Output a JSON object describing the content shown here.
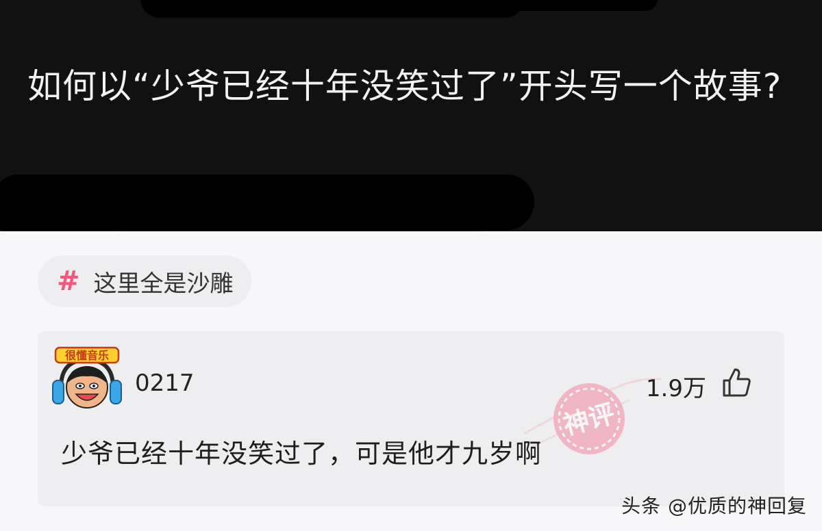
{
  "post": {
    "question": "如何以“少爷已经十年没笑过了”开头写一个故事?"
  },
  "topic": {
    "label": "这里全是沙雕",
    "icon": "hash-icon",
    "color": "#f2577f"
  },
  "comment": {
    "username": "0217",
    "likes": "1.9万",
    "text": "少爷已经十年没笑过了，可是他才九岁啊",
    "avatar_badge": "很懂音乐",
    "stamp_text": "神评"
  },
  "watermark": "头条 @优质的神回复"
}
